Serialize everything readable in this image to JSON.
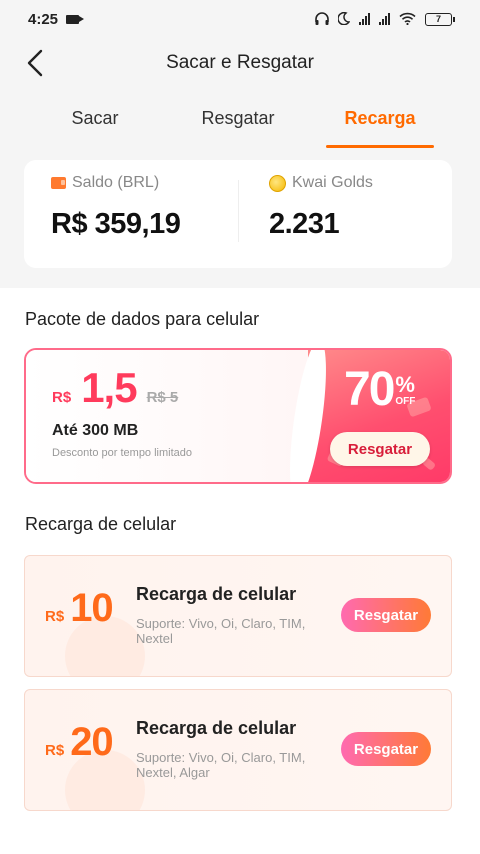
{
  "status_bar": {
    "time": "4:25",
    "battery": "7"
  },
  "header": {
    "title": "Sacar e Resgatar"
  },
  "tabs": [
    {
      "label": "Sacar",
      "active": false
    },
    {
      "label": "Resgatar",
      "active": false
    },
    {
      "label": "Recarga",
      "active": true
    }
  ],
  "balance": {
    "brl": {
      "label": "Saldo (BRL)",
      "value": "R$ 359,19"
    },
    "golds": {
      "label": "Kwai Golds",
      "value": "2.231"
    }
  },
  "data_section": {
    "title": "Pacote de dados para celular",
    "promo": {
      "currency": "R$",
      "price": "1,5",
      "old_price": "R$ 5",
      "subtitle": "Até 300 MB",
      "note": "Desconto por tempo limitado",
      "discount": "70",
      "percent_symbol": "%",
      "off_label": "OFF",
      "button": "Resgatar"
    }
  },
  "topup_section": {
    "title": "Recarga de celular",
    "items": [
      {
        "currency": "R$",
        "value": "10",
        "title": "Recarga de celular",
        "support": "Suporte: Vivo, Oi, Claro, TIM, Nextel",
        "button": "Resgatar"
      },
      {
        "currency": "R$",
        "value": "20",
        "title": "Recarga de celular",
        "support": "Suporte: Vivo, Oi, Claro, TIM, Nextel, Algar",
        "button": "Resgatar"
      }
    ]
  },
  "colors": {
    "accent": "#ff6a00",
    "promo_red": "#ff3b5c",
    "topup_orange": "#ff6a1a"
  }
}
